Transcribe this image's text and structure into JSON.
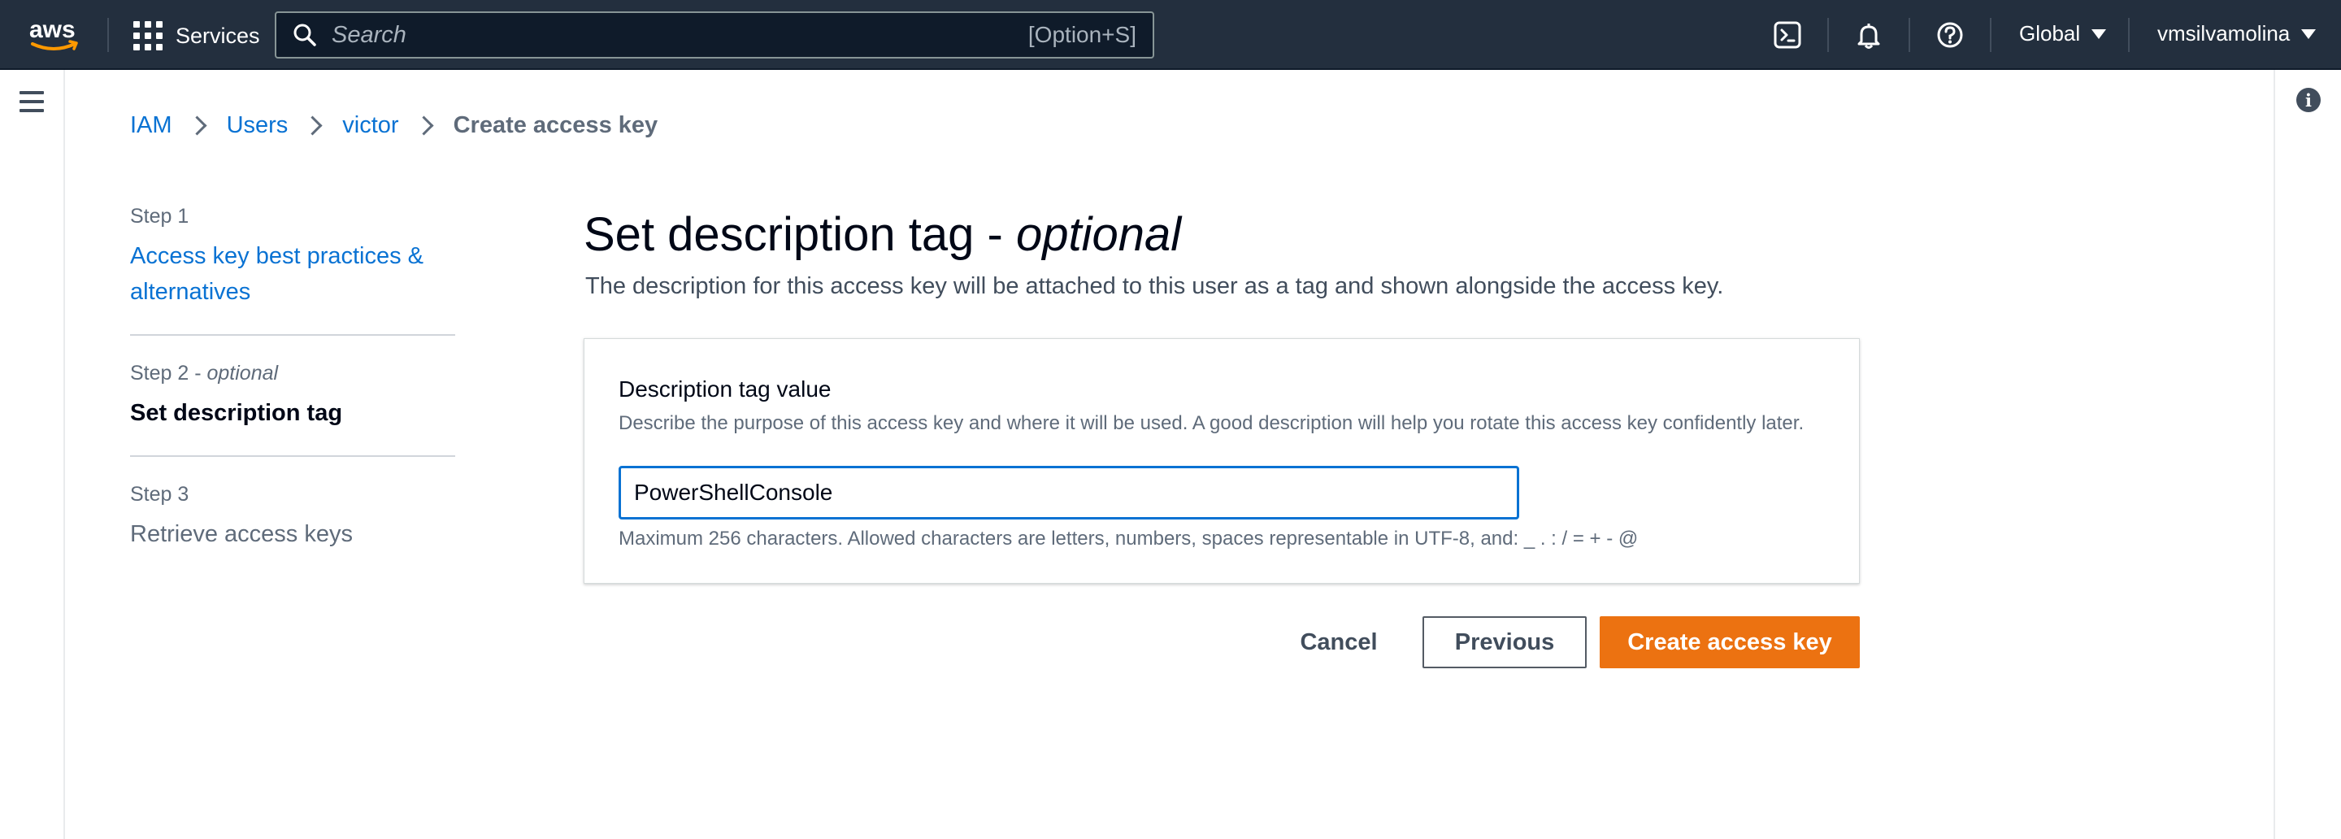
{
  "topbar": {
    "logo_text": "aws",
    "services_label": "Services",
    "search_placeholder": "Search",
    "search_shortcut": "[Option+S]",
    "region_label": "Global",
    "account_label": "vmsilvamolina",
    "icons": [
      "cloudshell-icon",
      "bell-icon",
      "help-icon"
    ]
  },
  "breadcrumb": {
    "items": [
      "IAM",
      "Users",
      "victor"
    ],
    "current": "Create access key"
  },
  "steps": [
    {
      "number": "Step 1",
      "title": "Access key best practices & alternatives",
      "state": "link"
    },
    {
      "number": "Step 2",
      "number_suffix": " - ",
      "optional": "optional",
      "title": "Set description tag",
      "state": "active"
    },
    {
      "number": "Step 3",
      "title": "Retrieve access keys",
      "state": "disabled"
    }
  ],
  "main": {
    "title": "Set description tag - ",
    "title_italic": "optional",
    "description": "The description for this access key will be attached to this user as a tag and shown alongside the access key."
  },
  "form": {
    "label": "Description tag value",
    "description": "Describe the purpose of this access key and where it will be used. A good description will help you rotate this access key confidently later.",
    "value": "PowerShellConsole",
    "hint": "Maximum 256 characters. Allowed characters are letters, numbers, spaces representable in UTF-8, and: _ . : / = + - @"
  },
  "actions": {
    "cancel": "Cancel",
    "previous": "Previous",
    "primary": "Create access key"
  },
  "colors": {
    "nav_background": "#232f3e",
    "link": "#0972d3",
    "primary_button": "#ec7211",
    "input_focus": "#0972d3"
  }
}
